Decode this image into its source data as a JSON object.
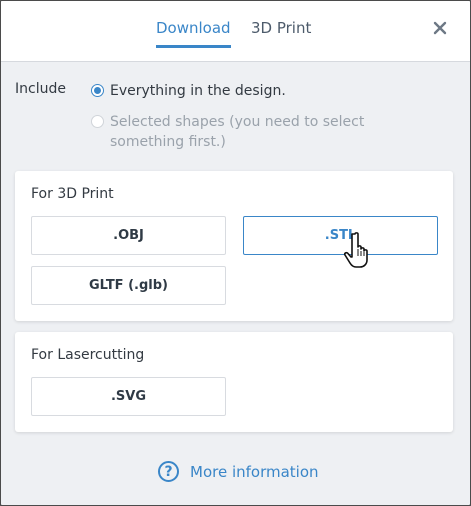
{
  "tabs": [
    {
      "label": "Download"
    },
    {
      "label": "3D Print"
    }
  ],
  "include": {
    "label": "Include",
    "option_all": "Everything in the design.",
    "option_selected": "Selected shapes (you need to select something first.)"
  },
  "print3d": {
    "title": "For 3D Print",
    "obj": ".OBJ",
    "stl": ".STL",
    "gltf": "GLTF (.glb)"
  },
  "laser": {
    "title": "For Lasercutting",
    "svg": ".SVG"
  },
  "footer": {
    "more_info": "More information"
  },
  "icons": {
    "close": "close-icon",
    "help": "question-circle-icon",
    "cursor": "hand-pointer-icon"
  },
  "colors": {
    "accent": "#3a86c8",
    "text": "#333a42"
  }
}
